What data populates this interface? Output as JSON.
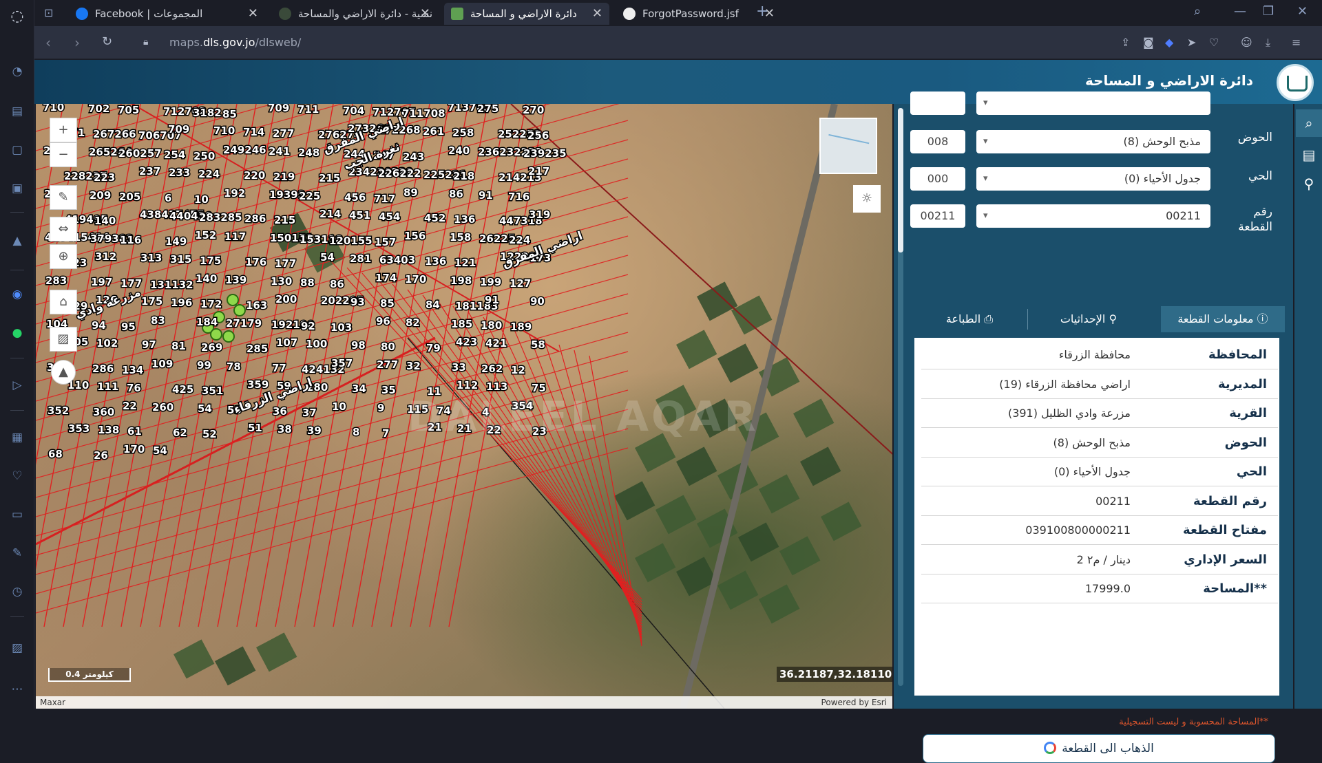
{
  "browser": {
    "tabs": [
      {
        "title": "Facebook | المجموعات",
        "active": false
      },
      {
        "title": "نسية - دائرة الاراضي والمساحة",
        "active": false
      },
      {
        "title": "دائرة الاراضي و المساحة",
        "active": true
      },
      {
        "title": "ForgotPassword.jsf",
        "active": false
      }
    ],
    "new_tab": "+",
    "url_prefix": "maps.",
    "url_host": "dls.gov.jo",
    "url_path": "/dlsweb/"
  },
  "header": {
    "title": "دائرة الاراضي و المساحة"
  },
  "form": {
    "basin_label": "الحوض",
    "basin_value": "مذبح الوحش (8)",
    "basin_code": "008",
    "neighborhood_label": "الحي",
    "neighborhood_value": "جدول الأحياء (0)",
    "neighborhood_code": "000",
    "parcel_label": "رقم القطعة",
    "parcel_value": "00211",
    "parcel_code": "00211"
  },
  "info_tabs": {
    "parcel_info": "معلومات القطعة",
    "coordinates": "الإحداثيات",
    "print": "الطباعة"
  },
  "parcel_info": [
    {
      "key": "المحافظة",
      "value": "محافظة الزرقاء"
    },
    {
      "key": "المديرية",
      "value": "اراضي محافظة الزرقاء (19)"
    },
    {
      "key": "القرية",
      "value": "مزرعة وادي الظليل (391)"
    },
    {
      "key": "الحوض",
      "value": "مذبح الوحش (8)"
    },
    {
      "key": "الحي",
      "value": "جدول الأحياء (0)"
    },
    {
      "key": "رقم القطعة",
      "value": "00211"
    },
    {
      "key": "مفتاح القطعة",
      "value": "039100800000211"
    },
    {
      "key": "السعر الإداري",
      "value": "2 دينار / م٢"
    },
    {
      "key": "المساحة**",
      "value": "17999.0"
    }
  ],
  "area_note": "المساحة المحسوبة و ليست التسجيلية**",
  "goto_button": "الذهاب الى القطعة",
  "map": {
    "scale": "0.4 كيلومتر",
    "coordinates": "36.21187,32.18110",
    "attribution_left": "Maxar",
    "attribution_right": "Powered by Esri",
    "watermark": "DALEEL AQAR",
    "area_labels": [
      "اراضي المفرق",
      "ثغرة الجب",
      "مزرعة وادي",
      "اراضي الزرقاء",
      "اراضي المفرق"
    ],
    "parcel_labels": [
      "710",
      "702",
      "705",
      "712702",
      "3182",
      "85",
      "709",
      "711",
      "704",
      "712707",
      "711708",
      "713705",
      "275",
      "270",
      "271",
      "267266",
      "706707",
      "709",
      "710",
      "714",
      "277",
      "276274",
      "273269",
      "272268",
      "261",
      "258",
      "252251",
      "256",
      "255",
      "265264",
      "260257",
      "254",
      "250",
      "249246",
      "241",
      "248",
      "244",
      "247",
      "243",
      "240",
      "236232231",
      "239235",
      "228227",
      "223",
      "237",
      "233",
      "224",
      "220",
      "219",
      "215",
      "234230229",
      "226222",
      "225221",
      "218",
      "214213",
      "217",
      "210",
      "209",
      "205",
      "6",
      "10",
      "192",
      "19393",
      "225",
      "456",
      "717",
      "89",
      "86",
      "91",
      "716",
      "419495",
      "140",
      "438437455",
      "440439",
      "283285",
      "286",
      "215",
      "214",
      "451",
      "454",
      "452",
      "136",
      "447318",
      "319",
      "418415414",
      "379383",
      "116",
      "149",
      "152",
      "117",
      "150151",
      "153118",
      "120155",
      "157",
      "156",
      "158",
      "26225",
      "224",
      "223",
      "312",
      "313",
      "315",
      "175",
      "176",
      "177",
      "54",
      "281",
      "63403",
      "136",
      "121",
      "122284",
      "173",
      "283",
      "197",
      "177",
      "131132",
      "140",
      "139",
      "130",
      "88",
      "86",
      "174",
      "170",
      "198",
      "199",
      "127",
      "129",
      "126",
      "175",
      "196",
      "172",
      "163",
      "200",
      "202205",
      "93",
      "85",
      "84",
      "181183",
      "91",
      "90",
      "104",
      "94",
      "95",
      "83",
      "184",
      "27179",
      "192190",
      "92",
      "103",
      "96",
      "82",
      "185",
      "180",
      "189",
      "105",
      "102",
      "97",
      "81",
      "269",
      "285",
      "107",
      "100",
      "98",
      "80",
      "79",
      "423",
      "421",
      "58",
      "31",
      "286",
      "134",
      "109",
      "99",
      "78",
      "77",
      "424132",
      "357",
      "277",
      "32",
      "33",
      "262",
      "12",
      "110",
      "111",
      "76",
      "425",
      "351",
      "359",
      "59",
      "280",
      "34",
      "35",
      "11",
      "112",
      "113",
      "75",
      "352",
      "360",
      "22",
      "260",
      "54",
      "53",
      "36",
      "37",
      "10",
      "9",
      "115",
      "74",
      "4",
      "354",
      "353",
      "138",
      "61",
      "62",
      "52",
      "51",
      "38",
      "39",
      "8",
      "7",
      "21",
      "21",
      "22",
      "23",
      "68",
      "26",
      "170",
      "54"
    ]
  }
}
